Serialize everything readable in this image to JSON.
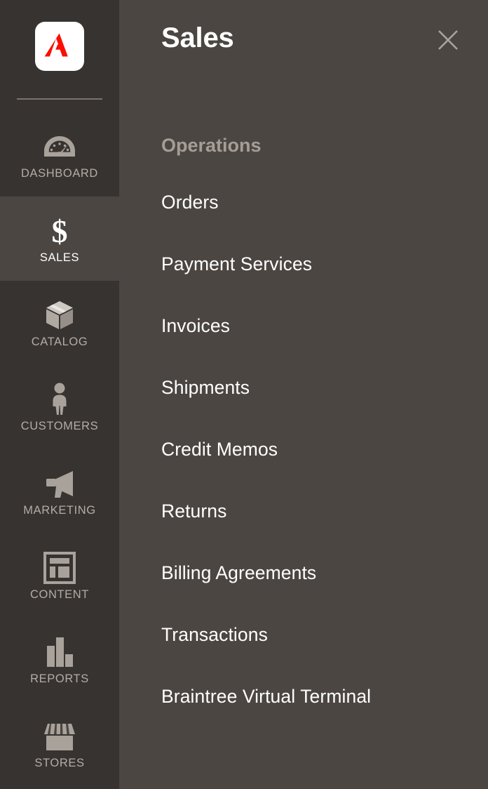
{
  "colors": {
    "rail_bg": "#373330",
    "panel_bg": "#4b4642",
    "rail_label": "#b3aca6",
    "rail_label_active": "#ffffff",
    "icon_fill": "#a9a29b",
    "group_title": "#a59d96",
    "menu_text": "#ffffff",
    "logo_red": "#fa0f00",
    "logo_tile": "#ffffff",
    "divider": "#7a736d",
    "close_icon": "#a9a29b"
  },
  "rail": {
    "logo": {
      "name": "adobe-commerce-logo",
      "alt": "Adobe"
    },
    "divider": true,
    "items": [
      {
        "label": "DASHBOARD",
        "icon": "dashboard-gauge-icon",
        "active": false
      },
      {
        "label": "SALES",
        "icon": "dollar-sign-icon",
        "active": true
      },
      {
        "label": "CATALOG",
        "icon": "box-icon",
        "active": false
      },
      {
        "label": "CUSTOMERS",
        "icon": "person-icon",
        "active": false
      },
      {
        "label": "MARKETING",
        "icon": "megaphone-icon",
        "active": false
      },
      {
        "label": "CONTENT",
        "icon": "page-layout-icon",
        "active": false
      },
      {
        "label": "REPORTS",
        "icon": "bar-chart-icon",
        "active": false
      },
      {
        "label": "STORES",
        "icon": "storefront-icon",
        "active": false
      }
    ]
  },
  "panel": {
    "title": "Sales",
    "close_icon": "close-icon",
    "groups": [
      {
        "title": "Operations",
        "items": [
          {
            "label": "Orders"
          },
          {
            "label": "Payment Services"
          },
          {
            "label": "Invoices"
          },
          {
            "label": "Shipments"
          },
          {
            "label": "Credit Memos"
          },
          {
            "label": "Returns"
          },
          {
            "label": "Billing Agreements"
          },
          {
            "label": "Transactions"
          },
          {
            "label": "Braintree Virtual Terminal"
          }
        ]
      }
    ]
  }
}
